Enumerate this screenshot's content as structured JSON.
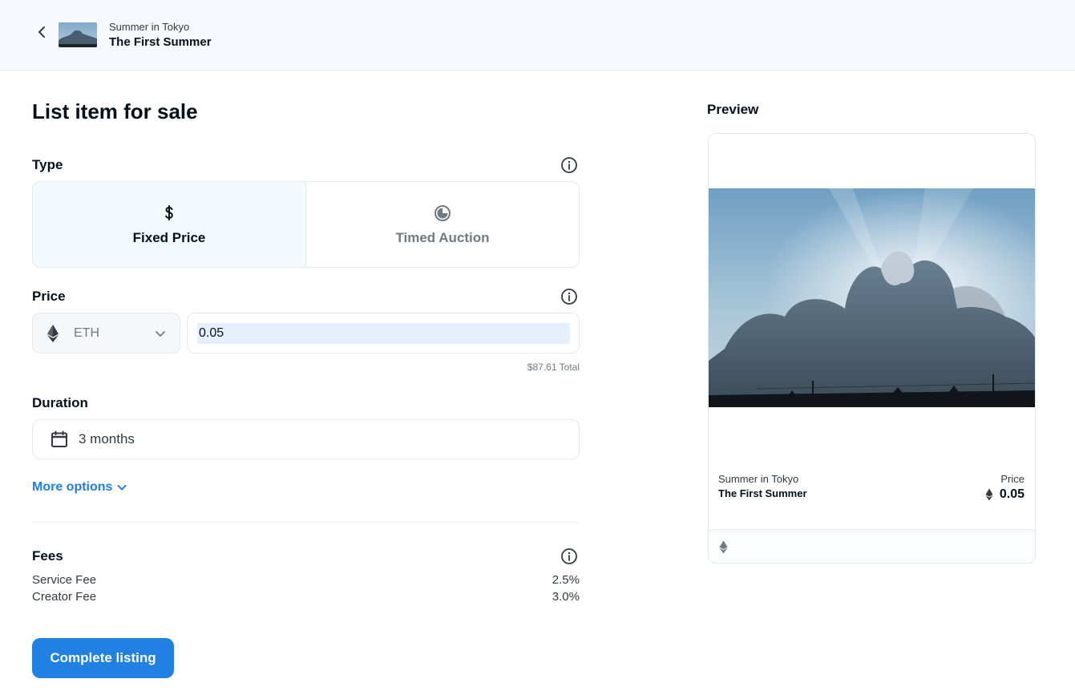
{
  "header": {
    "collection": "Summer in Tokyo",
    "item_name": "The First Summer"
  },
  "form": {
    "title": "List item for sale",
    "type": {
      "label": "Type",
      "options": [
        {
          "label": "Fixed Price",
          "icon": "dollar-icon",
          "selected": true
        },
        {
          "label": "Timed Auction",
          "icon": "clock-icon",
          "selected": false
        }
      ]
    },
    "price": {
      "label": "Price",
      "currency": "ETH",
      "amount": "0.05",
      "total": "$87.61 Total"
    },
    "duration": {
      "label": "Duration",
      "value": "3 months"
    },
    "more_options": "More options",
    "fees": {
      "label": "Fees",
      "rows": [
        {
          "name": "Service Fee",
          "value": "2.5%"
        },
        {
          "name": "Creator Fee",
          "value": "3.0%"
        }
      ]
    },
    "submit_label": "Complete listing"
  },
  "preview": {
    "label": "Preview",
    "collection": "Summer in Tokyo",
    "item_name": "The First Summer",
    "price_label": "Price",
    "price": "0.05"
  },
  "colors": {
    "accent": "#2081e2",
    "selected_bg": "#f3f9fc",
    "header_bg": "#f6f9fd"
  }
}
